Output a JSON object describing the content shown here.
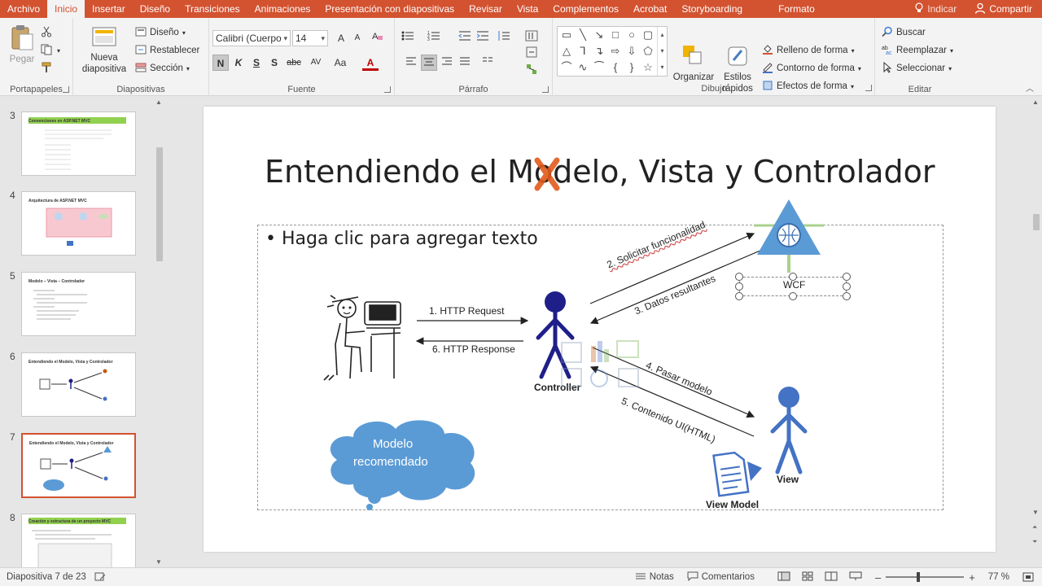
{
  "tabs": [
    "Archivo",
    "Inicio",
    "Insertar",
    "Diseño",
    "Transiciones",
    "Animaciones",
    "Presentación con diapositivas",
    "Revisar",
    "Vista",
    "Complementos",
    "Acrobat",
    "Storyboarding"
  ],
  "active_tab": "Inicio",
  "contextual_tab": "Formato",
  "tell_me": "Indicar",
  "share": "Compartir",
  "ribbon": {
    "clipboard": {
      "label": "Portapapeles",
      "paste": "Pegar"
    },
    "slides": {
      "label": "Diapositivas",
      "new_slide": "Nueva",
      "new_slide2": "diapositiva",
      "layout": "Diseño",
      "reset": "Restablecer",
      "section": "Sección"
    },
    "font": {
      "label": "Fuente",
      "font_name": "Calibri (Cuerpo",
      "font_size": "14",
      "bold": "N",
      "italic": "K",
      "underline": "S",
      "shadow": "S",
      "strike": "abc",
      "spacing": "AV",
      "case": "Aa",
      "color": "A",
      "grow": "A",
      "shrink": "A"
    },
    "paragraph": {
      "label": "Párrafo"
    },
    "drawing": {
      "label": "Dibujo",
      "arrange": "Organizar",
      "quick_styles": "Estilos",
      "quick_styles2": "rápidos",
      "fill": "Relleno de forma",
      "outline": "Contorno de forma",
      "effects": "Efectos de forma"
    },
    "editing": {
      "label": "Editar",
      "find": "Buscar",
      "replace": "Reemplazar",
      "select": "Seleccionar"
    }
  },
  "thumbnails": [
    {
      "num": "3",
      "title": "Convenciones en ASP.NET MVC"
    },
    {
      "num": "4",
      "title": "Arquitectura de ASP.NET MVC"
    },
    {
      "num": "5",
      "title": "Modelo – Vista – Controlador"
    },
    {
      "num": "6",
      "title": "Entendiendo el Modelo, Vista y Controlador"
    },
    {
      "num": "7",
      "title": "Entendiendo el Modelo, Vista y Controlador"
    },
    {
      "num": "8",
      "title": "Creación y estructura de un proyecto MVC"
    }
  ],
  "slide": {
    "title": "Entendiendo el Modelo, Vista y Controlador",
    "bullet": "• Haga clic para agregar texto",
    "http_request": "1. HTTP Request",
    "http_response": "6. HTTP Response",
    "controller": "Controller",
    "view": "View",
    "view_model": "View Model",
    "wcf": "WCF",
    "solicitar": "2. Solicitar funcionalidad",
    "datos": "3. Datos resultantes",
    "pasar": "4. Pasar modelo",
    "contenido": "5. Contenido UI(HTML)",
    "modelo1": "Modelo",
    "modelo2": "recomendado"
  },
  "status": {
    "slide_count": "Diapositiva 7 de 23",
    "notes": "Notas",
    "comments": "Comentarios",
    "zoom": "77 %"
  },
  "colors": {
    "accent": "#d35230",
    "stick_figure": "#1f1f8a",
    "view_figure": "#4472c4",
    "cloud": "#5b9bd5",
    "thumb_bar": "#92d050"
  }
}
